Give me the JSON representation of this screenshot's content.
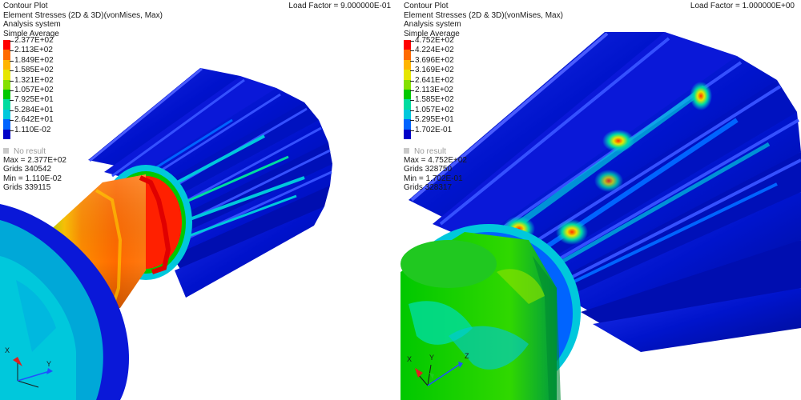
{
  "left": {
    "title": "Contour Plot",
    "result": "Element Stresses (2D & 3D)(vonMises, Max)",
    "system": "Analysis system",
    "averaging": "Simple Average",
    "load_factor": "Load Factor = 9.000000E-01",
    "legend": [
      {
        "label": "2.377E+02",
        "color": "#ff0000"
      },
      {
        "label": "2.113E+02",
        "color": "#ff6a00"
      },
      {
        "label": "1.849E+02",
        "color": "#ffb400"
      },
      {
        "label": "1.585E+02",
        "color": "#e6e600"
      },
      {
        "label": "1.321E+02",
        "color": "#84e000"
      },
      {
        "label": "1.057E+02",
        "color": "#00c800"
      },
      {
        "label": "7.925E+01",
        "color": "#00dca0"
      },
      {
        "label": "5.284E+01",
        "color": "#00c8dc"
      },
      {
        "label": "2.642E+01",
        "color": "#0064ff"
      },
      {
        "label": "1.110E-02",
        "color": "#0000c8"
      }
    ],
    "no_result": "No result",
    "max": "Max = 2.377E+02",
    "max_grid": "Grids 340542",
    "min": "Min = 1.110E-02",
    "min_grid": "Grids 339115",
    "axes": {
      "x": "X",
      "y": "Y"
    }
  },
  "right": {
    "title": "Contour Plot",
    "result": "Element Stresses (2D & 3D)(vonMises, Max)",
    "system": "Analysis system",
    "averaging": "Simple Average",
    "load_factor": "Load Factor = 1.000000E+00",
    "legend": [
      {
        "label": "4.752E+02",
        "color": "#ff0000"
      },
      {
        "label": "4.224E+02",
        "color": "#ff6a00"
      },
      {
        "label": "3.696E+02",
        "color": "#ffb400"
      },
      {
        "label": "3.169E+02",
        "color": "#e6e600"
      },
      {
        "label": "2.641E+02",
        "color": "#84e000"
      },
      {
        "label": "2.113E+02",
        "color": "#00c800"
      },
      {
        "label": "1.585E+02",
        "color": "#00dca0"
      },
      {
        "label": "1.057E+02",
        "color": "#00c8dc"
      },
      {
        "label": "5.295E+01",
        "color": "#0064ff"
      },
      {
        "label": "1.702E-01",
        "color": "#0000c8"
      }
    ],
    "no_result": "No result",
    "max": "Max = 4.752E+02",
    "max_grid": "Grids 328750",
    "min": "Min = 1.702E-01",
    "min_grid": "Grids 328317",
    "axes": {
      "x": "X",
      "y": "Y",
      "z": "Z"
    }
  }
}
